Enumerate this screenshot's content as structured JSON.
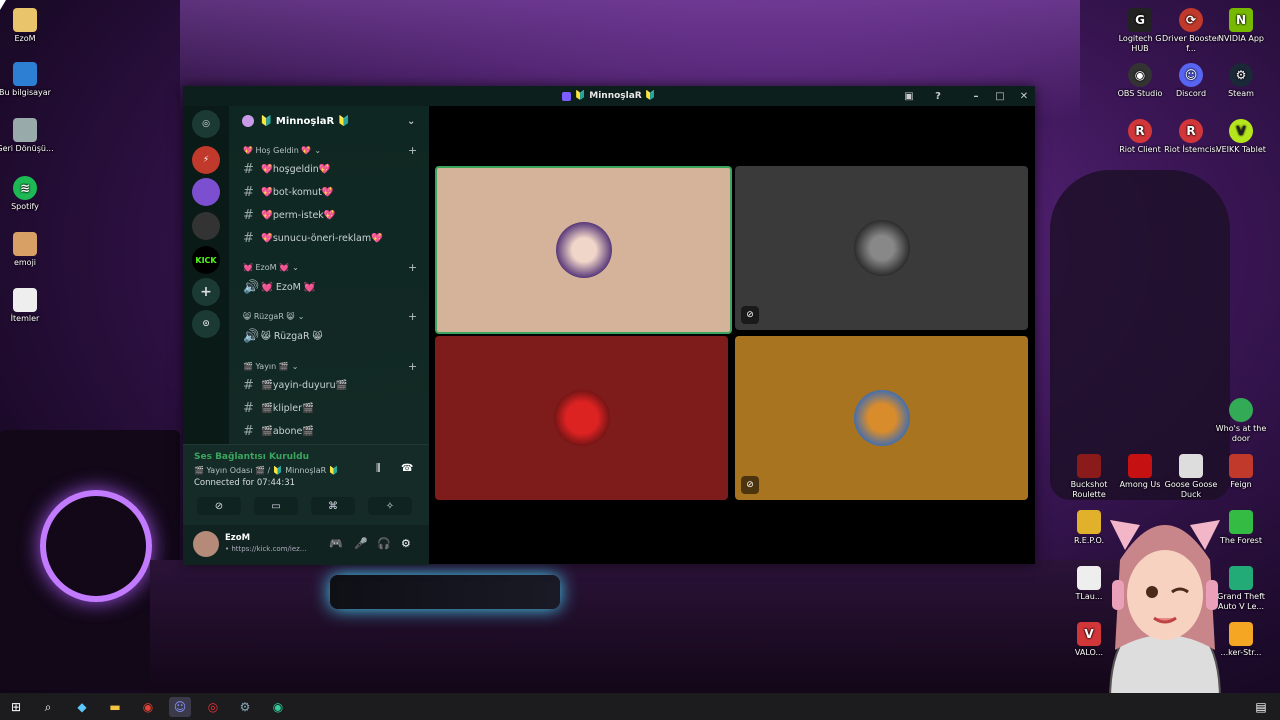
{
  "window": {
    "title": "Minnoşla R",
    "title_text": "🔰 MinnoşlaR 🔰"
  },
  "server": {
    "name": "🔰 MinnoşlaR 🔰"
  },
  "categories": [
    {
      "label": "💖 Hoş Geldin 💖"
    },
    {
      "label": "💓 EzoM 💓"
    },
    {
      "label": "😸 RüzgaR 😸"
    },
    {
      "label": "🎬 Yayın 🎬"
    }
  ],
  "channels": [
    {
      "label": "💖hoşgeldin💖"
    },
    {
      "label": "💖bot-komut💖"
    },
    {
      "label": "💖perm-istek💖"
    },
    {
      "label": "💖sunucu-öneri-reklam💖"
    },
    {
      "label": "💓 EzoM 💓"
    },
    {
      "label": "😸 RüzgaR 😸"
    },
    {
      "label": "🎬yayin-duyuru🎬"
    },
    {
      "label": "🎬klipler🎬"
    },
    {
      "label": "🎬abone🎬"
    }
  ],
  "voice": {
    "status": "Ses Bağlantısı Kuruldu",
    "room": "🎬 Yayın Odası 🎬 / 🔰 MinnoşlaR 🔰",
    "connected": "Connected for 07:44:31"
  },
  "user": {
    "name": "EzoM",
    "status": "• https://kick.com/iez..."
  },
  "tiles": [
    {
      "bg": "#d4b39a",
      "speaking": true,
      "muted": false
    },
    {
      "bg": "#3a3a3a",
      "speaking": false,
      "muted": true
    },
    {
      "bg": "#7e1c1c",
      "speaking": false,
      "muted": false
    },
    {
      "bg": "#a87420",
      "speaking": false,
      "muted": true
    }
  ],
  "desktop_left": [
    {
      "label": "EzoM"
    },
    {
      "label": "Bu bilgisayar"
    },
    {
      "label": "Geri Dönüşü..."
    },
    {
      "label": "Spotify"
    },
    {
      "label": "emoji"
    },
    {
      "label": "İtemler"
    }
  ],
  "desktop_right": [
    {
      "label": "Logitech G HUB"
    },
    {
      "label": "Driver Booster f..."
    },
    {
      "label": "NVIDIA App"
    },
    {
      "label": "OBS Studio"
    },
    {
      "label": "Discord"
    },
    {
      "label": "Steam"
    },
    {
      "label": "Riot Client"
    },
    {
      "label": "Riot İstemcisi"
    },
    {
      "label": "VEIKK Tablet"
    },
    {
      "label": "Who's at the door"
    },
    {
      "label": "Buckshot Roulette"
    },
    {
      "label": "Among Us"
    },
    {
      "label": "Goose Goose Duck"
    },
    {
      "label": "Feign"
    },
    {
      "label": "R.E.P.O."
    },
    {
      "label": "The Forest"
    },
    {
      "label": "Grand Theft Auto V Le..."
    },
    {
      "label": "TLau..."
    },
    {
      "label": "VALO..."
    },
    {
      "label": "...ker-Str..."
    }
  ],
  "colors": {
    "accent": "#3ba55d",
    "speaking_ring": "#3ba55d"
  }
}
